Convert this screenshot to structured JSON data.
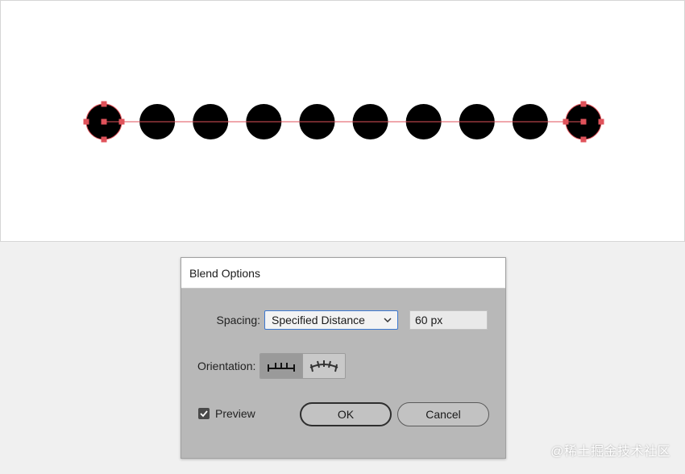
{
  "dialog": {
    "title": "Blend Options",
    "spacing_label": "Spacing:",
    "spacing_selected": "Specified Distance",
    "distance_value": "60 px",
    "orientation_label": "Orientation:",
    "orientation_selected": "align-to-page",
    "preview_label": "Preview",
    "preview_checked": true,
    "ok_label": "OK",
    "cancel_label": "Cancel"
  },
  "canvas": {
    "blend_step_count": 10,
    "fill_color": "#000000",
    "selection_color": "#e0525a"
  },
  "watermark": "@稀土掘金技术社区"
}
